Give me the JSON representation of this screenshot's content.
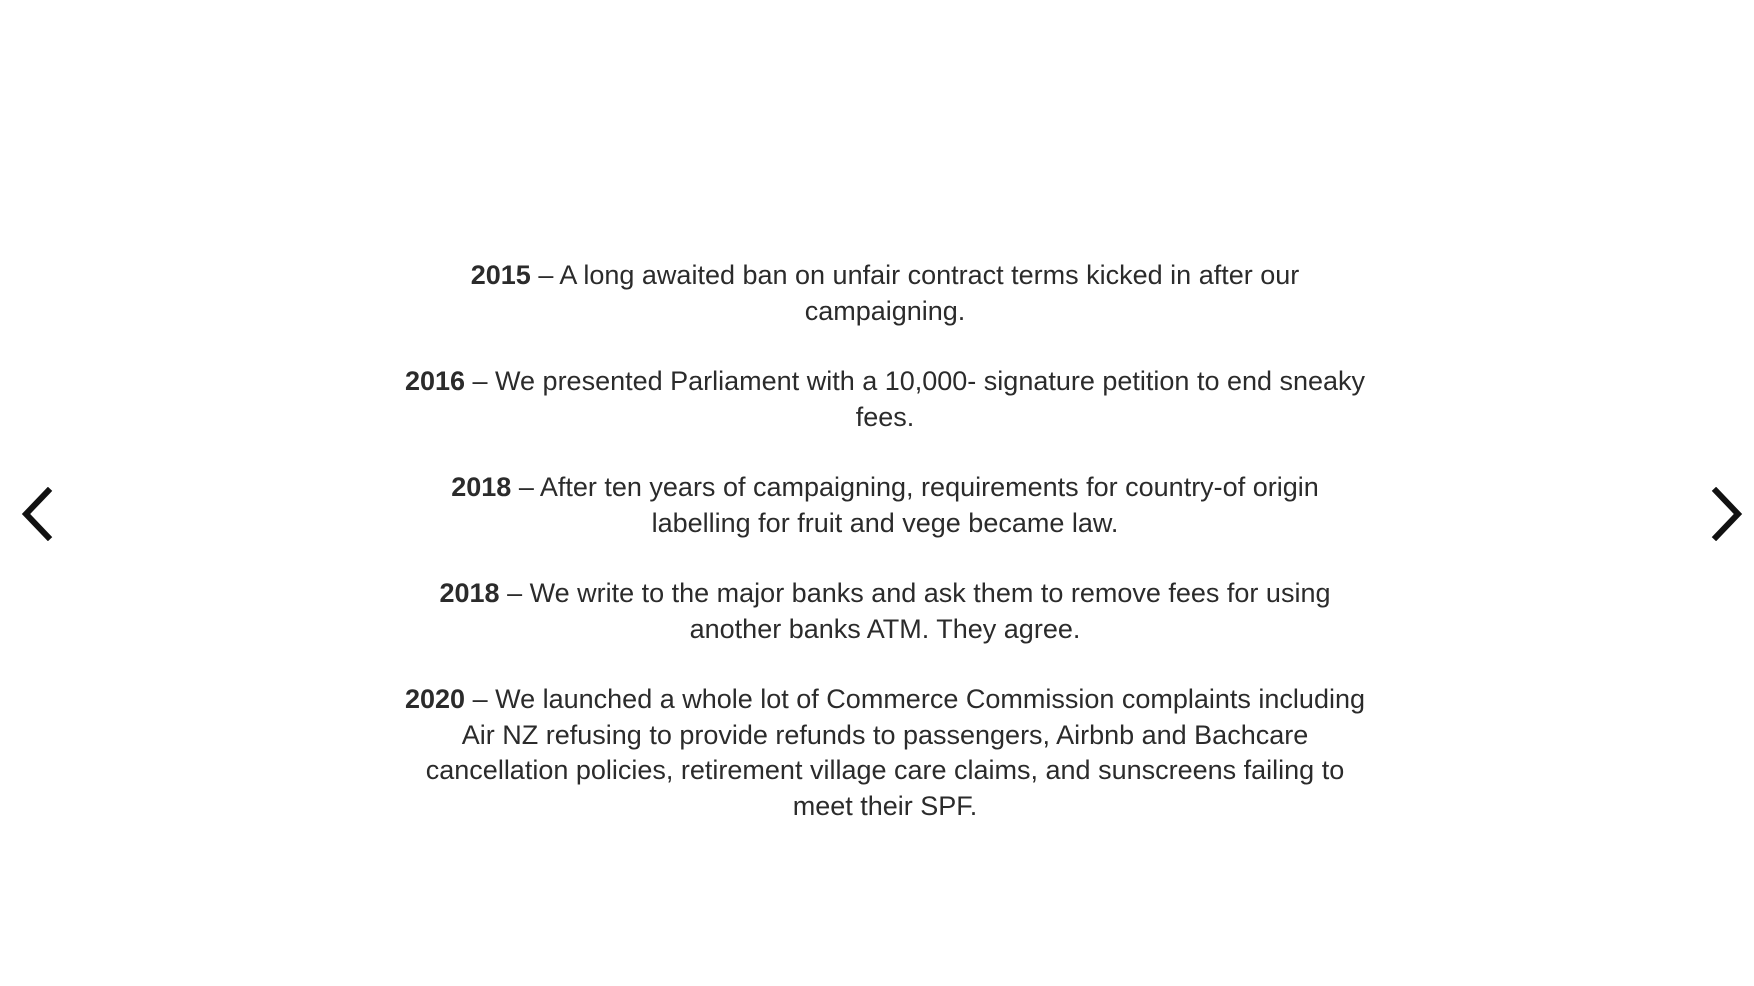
{
  "slideshow": {
    "prev_icon": "chevron-left-icon",
    "next_icon": "chevron-right-icon",
    "entries": [
      {
        "year": "2015",
        "text": " – A long awaited ban on unfair contract terms kicked in after our campaigning."
      },
      {
        "year": "2016",
        "text": " – We presented Parliament with a 10,000- signature petition to end sneaky fees."
      },
      {
        "year": "2018",
        "text": " – After ten years of campaigning, requirements for country-of origin labelling for fruit and vege became law."
      },
      {
        "year": "2018",
        "text": " – We write to the major banks and ask them to remove fees for using another banks ATM. They agree."
      },
      {
        "year": "2020",
        "text": " – We launched a whole lot of Commerce Commission complaints including Air NZ refusing to provide refunds to passengers, Airbnb and Bachcare cancellation policies, retirement village care claims, and sunscreens failing to meet their SPF."
      }
    ]
  }
}
